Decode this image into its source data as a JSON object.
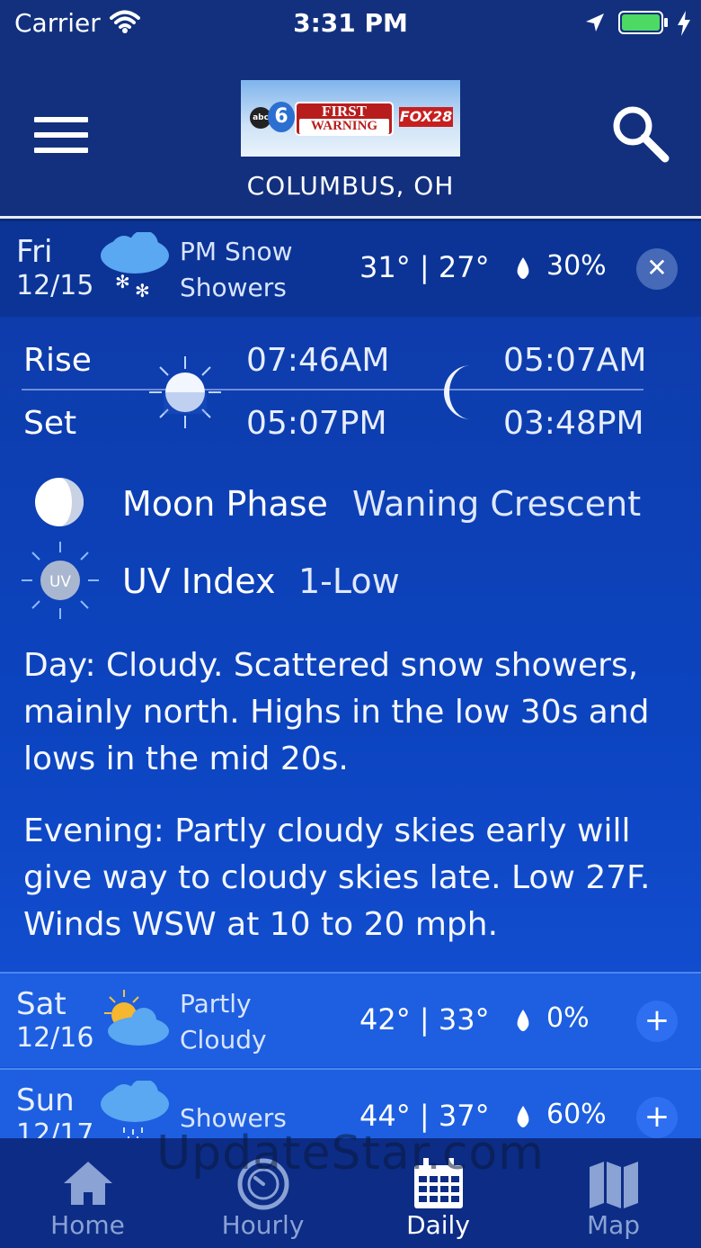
{
  "status_bar": {
    "carrier": "Carrier",
    "time": "3:31 PM",
    "icons": [
      "wifi-icon",
      "location-arrow-icon",
      "battery-icon",
      "charging-bolt-icon"
    ]
  },
  "header": {
    "logo_text": {
      "abc": "abc",
      "channel": "6",
      "first_warning_line1": "FIRST",
      "first_warning_line2": "WARNING",
      "fox": "FOX28"
    },
    "location": "COLUMBUS, OH",
    "icons": [
      "menu-icon",
      "search-icon"
    ]
  },
  "selected_day": {
    "day": "Fri",
    "date": "12/15",
    "condition": "PM Snow Showers",
    "temps": "31° | 27°",
    "precip": "30%",
    "close_label": "✕",
    "icon": "snow-showers-icon"
  },
  "sun_moon": {
    "rise_label": "Rise",
    "set_label": "Set",
    "sunrise": "07:46AM",
    "sunset": "05:07PM",
    "moonrise": "05:07AM",
    "moonset": "03:48PM"
  },
  "moon_phase": {
    "label": "Moon Phase",
    "value": "Waning Crescent"
  },
  "uv_index": {
    "label": "UV Index",
    "value": "1-Low",
    "icon_text": "UV"
  },
  "forecast": {
    "day_text": "Day: Cloudy. Scattered snow showers, mainly north. Highs in the low 30s and lows in the mid 20s.",
    "evening_text": "Evening: Partly cloudy skies early will give way to cloudy skies late. Low 27F. Winds WSW at 10 to 20 mph."
  },
  "other_days": [
    {
      "day": "Sat",
      "date": "12/16",
      "condition": "Partly Cloudy",
      "temps": "42° | 33°",
      "precip": "0%",
      "expand_label": "+",
      "icon": "partly-cloudy-icon"
    },
    {
      "day": "Sun",
      "date": "12/17",
      "condition": "Showers",
      "temps": "44° | 37°",
      "precip": "60%",
      "expand_label": "+",
      "icon": "showers-icon"
    }
  ],
  "tabs": [
    {
      "label": "Home",
      "icon": "home-icon",
      "active": false
    },
    {
      "label": "Hourly",
      "icon": "clock-icon",
      "active": false
    },
    {
      "label": "Daily",
      "icon": "calendar-icon",
      "active": true
    },
    {
      "label": "Map",
      "icon": "map-icon",
      "active": false
    }
  ],
  "watermark": "UpdateStar.com",
  "colors": {
    "header_bg": "#12307e",
    "selected_row_bg": "#0b3496",
    "collapsed_row_bg": "#1d5fe0",
    "tab_inactive": "#8aa2d4",
    "tab_active": "#ffffff"
  }
}
